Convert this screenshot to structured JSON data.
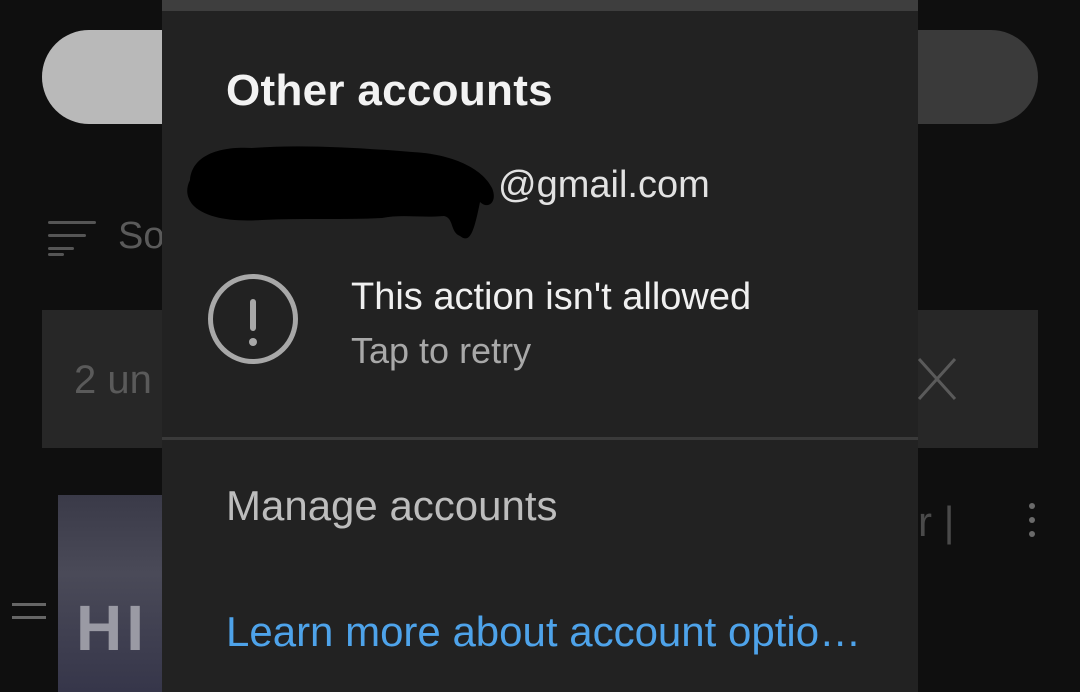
{
  "background": {
    "sort_label_fragment": "So",
    "banner_text_fragment": "2 un",
    "thumbnail_text": "HI",
    "item_title_fragment": "r |"
  },
  "dialog": {
    "section_title": "Other accounts",
    "account": {
      "email_visible_part": "@gmail.com"
    },
    "error": {
      "title": "This action isn't allowed",
      "subtitle": "Tap to retry",
      "icon": "alert-circle-icon"
    },
    "manage_accounts_label": "Manage accounts",
    "learn_more_label": "Learn more about account optio…",
    "link_color": "#4ea3ea"
  }
}
